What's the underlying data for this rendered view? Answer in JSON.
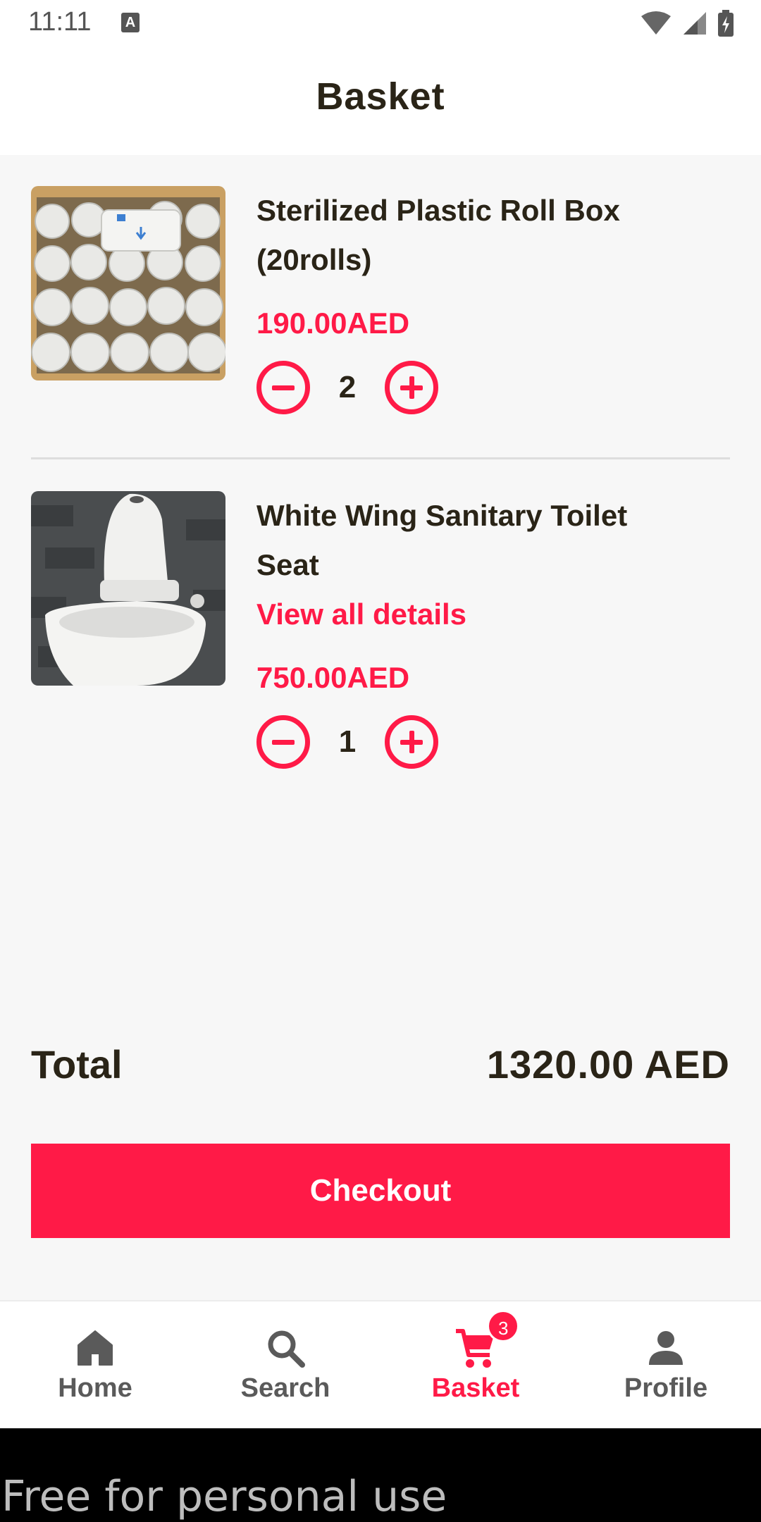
{
  "status_bar": {
    "time": "11:11",
    "notification_letter": "A"
  },
  "header": {
    "title": "Basket"
  },
  "cart": {
    "items": [
      {
        "name_line1": "Sterilized Plastic Roll Box",
        "name_line2": "(20rolls)",
        "price": "190.00AED",
        "quantity": "2"
      },
      {
        "name_line1": "White Wing Sanitary Toilet",
        "name_line2": "Seat",
        "details_link": "View all details",
        "price": "750.00AED",
        "quantity": "1"
      }
    ]
  },
  "summary": {
    "total_label": "Total",
    "total_value": "1320.00 AED"
  },
  "checkout": {
    "label": "Checkout"
  },
  "nav": {
    "items": [
      {
        "label": "Home",
        "icon": "home-icon"
      },
      {
        "label": "Search",
        "icon": "search-icon"
      },
      {
        "label": "Basket",
        "icon": "cart-icon",
        "badge": "3",
        "active": true
      },
      {
        "label": "Profile",
        "icon": "person-icon"
      }
    ]
  },
  "footer": {
    "watermark": "Free for personal use"
  },
  "colors": {
    "accent": "#ff1a47",
    "text": "#2a2417",
    "background": "#f7f7f7"
  }
}
